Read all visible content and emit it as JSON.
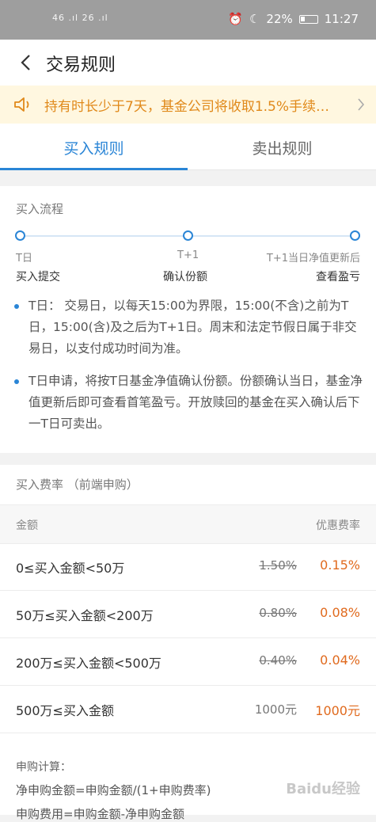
{
  "status_bar": {
    "signal_text": "46 .ıl 26 .ıl",
    "battery": "22%",
    "time": "11:27"
  },
  "header": {
    "title": "交易规则"
  },
  "notice": {
    "text": "持有时长少于7天，基金公司将收取1.5%手续…"
  },
  "tabs": [
    {
      "label": "买入规则",
      "active": true
    },
    {
      "label": "卖出规则",
      "active": false
    }
  ],
  "buy_process": {
    "title": "买入流程",
    "steps": [
      {
        "label": "T日",
        "action": "买入提交"
      },
      {
        "label": "T+1",
        "action": "确认份额"
      },
      {
        "label": "T+1当日净值更新后",
        "action": "查看盈亏"
      }
    ],
    "notes": [
      "T日： 交易日，以每天15:00为界限，15:00(不含)之前为T日，15:00(含)及之后为T+1日。周末和法定节假日属于非交易日，以支付成功时间为准。",
      "T日申请，将按T日基金净值确认份额。份额确认当日，基金净值更新后即可查看首笔盈亏。开放赎回的基金在买入确认后下一T日可卖出。"
    ]
  },
  "buy_fee": {
    "title": "买入费率 （前端申购）",
    "col_amount": "金额",
    "col_rate": "优惠费率",
    "rows": [
      {
        "range": "0≤买入金额<50万",
        "original": "1.50%",
        "discount": "0.15%",
        "strike": true
      },
      {
        "range": "50万≤买入金额<200万",
        "original": "0.80%",
        "discount": "0.08%",
        "strike": true
      },
      {
        "range": "200万≤买入金额<500万",
        "original": "0.40%",
        "discount": "0.04%",
        "strike": true
      },
      {
        "range": "500万≤买入金额",
        "original": "1000元",
        "discount": "1000元",
        "strike": false
      }
    ],
    "calc_title": "申购计算：",
    "calc_lines": [
      "净申购金额=申购金额/(1+申购费率)",
      "申购费用=申购金额-净申购金额"
    ]
  },
  "watermark": "Baidu经验",
  "colors": {
    "accent": "#2a85d6",
    "notice_text": "#e0891a",
    "discount": "#e06a1e"
  }
}
